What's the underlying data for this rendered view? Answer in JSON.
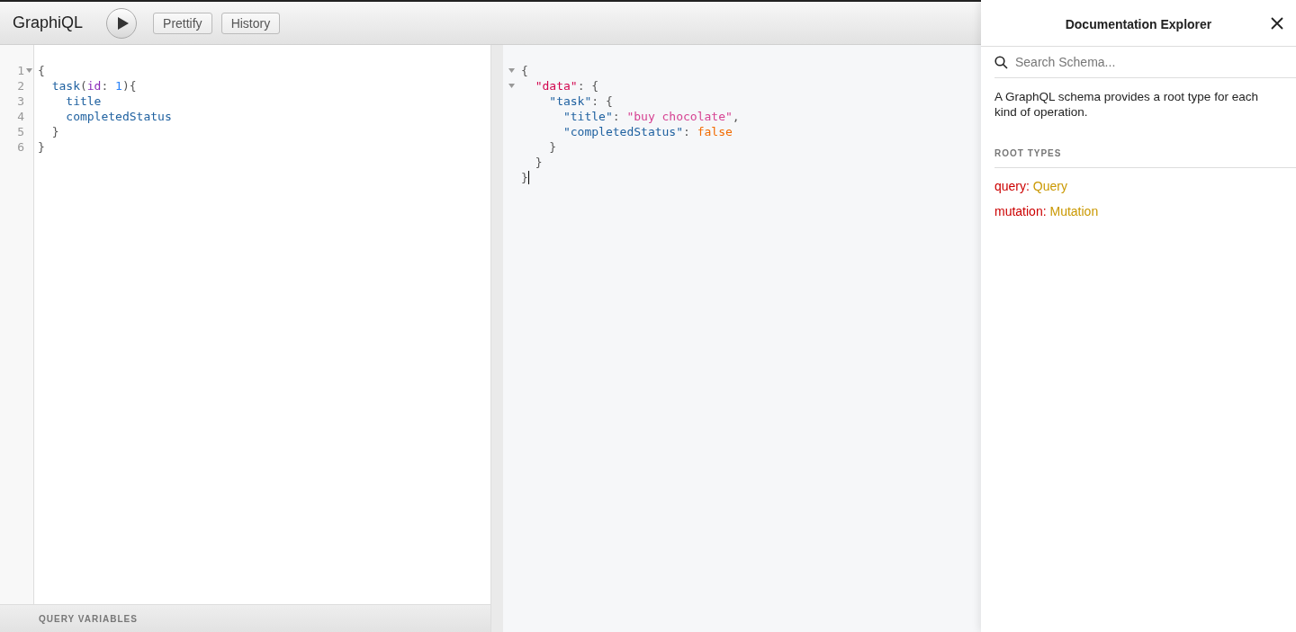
{
  "toolbar": {
    "logo": "GraphiQL",
    "buttons": [
      {
        "label": "Prettify"
      },
      {
        "label": "History"
      }
    ]
  },
  "query_editor": {
    "lines": [
      {
        "number": "1",
        "foldable": true,
        "tokens": [
          {
            "text": "{",
            "kind": "punct"
          }
        ]
      },
      {
        "number": "2",
        "foldable": false,
        "tokens": [
          {
            "text": "  task",
            "kind": "field"
          },
          {
            "text": "(",
            "kind": "punct"
          },
          {
            "text": "id",
            "kind": "attr"
          },
          {
            "text": ": ",
            "kind": "punct"
          },
          {
            "text": "1",
            "kind": "number"
          },
          {
            "text": "){",
            "kind": "punct"
          }
        ]
      },
      {
        "number": "3",
        "foldable": false,
        "tokens": [
          {
            "text": "    title",
            "kind": "field"
          }
        ]
      },
      {
        "number": "4",
        "foldable": false,
        "tokens": [
          {
            "text": "    completedStatus",
            "kind": "field"
          }
        ]
      },
      {
        "number": "5",
        "foldable": false,
        "tokens": [
          {
            "text": "  }",
            "kind": "punct"
          }
        ]
      },
      {
        "number": "6",
        "foldable": false,
        "tokens": [
          {
            "text": "}",
            "kind": "punct"
          }
        ]
      }
    ],
    "variables_label": "QUERY VARIABLES"
  },
  "result_viewer": {
    "lines": [
      {
        "foldable": true,
        "cursor": false,
        "tokens": [
          {
            "text": "{",
            "kind": "punct"
          }
        ]
      },
      {
        "foldable": true,
        "cursor": false,
        "tokens": [
          {
            "text": "  \"data\"",
            "kind": "root_key"
          },
          {
            "text": ": {",
            "kind": "punct"
          }
        ]
      },
      {
        "foldable": false,
        "cursor": false,
        "tokens": [
          {
            "text": "    \"task\"",
            "kind": "key"
          },
          {
            "text": ": {",
            "kind": "punct"
          }
        ]
      },
      {
        "foldable": false,
        "cursor": false,
        "tokens": [
          {
            "text": "      \"title\"",
            "kind": "key"
          },
          {
            "text": ": ",
            "kind": "punct"
          },
          {
            "text": "\"buy chocolate\"",
            "kind": "string"
          },
          {
            "text": ",",
            "kind": "punct"
          }
        ]
      },
      {
        "foldable": false,
        "cursor": false,
        "tokens": [
          {
            "text": "      \"completedStatus\"",
            "kind": "key"
          },
          {
            "text": ": ",
            "kind": "punct"
          },
          {
            "text": "false",
            "kind": "keyword"
          }
        ]
      },
      {
        "foldable": false,
        "cursor": false,
        "tokens": [
          {
            "text": "    }",
            "kind": "punct"
          }
        ]
      },
      {
        "foldable": false,
        "cursor": false,
        "tokens": [
          {
            "text": "  }",
            "kind": "punct"
          }
        ]
      },
      {
        "foldable": false,
        "cursor": true,
        "tokens": [
          {
            "text": "}",
            "kind": "punct"
          }
        ]
      }
    ]
  },
  "doc_explorer": {
    "title": "Documentation Explorer",
    "search": {
      "placeholder": "Search Schema..."
    },
    "description": "A GraphQL schema provides a root type for each kind of operation.",
    "section_title": "ROOT TYPES",
    "root_types": [
      {
        "name": "query:",
        "type": "Query"
      },
      {
        "name": "mutation:",
        "type": "Mutation"
      }
    ]
  }
}
